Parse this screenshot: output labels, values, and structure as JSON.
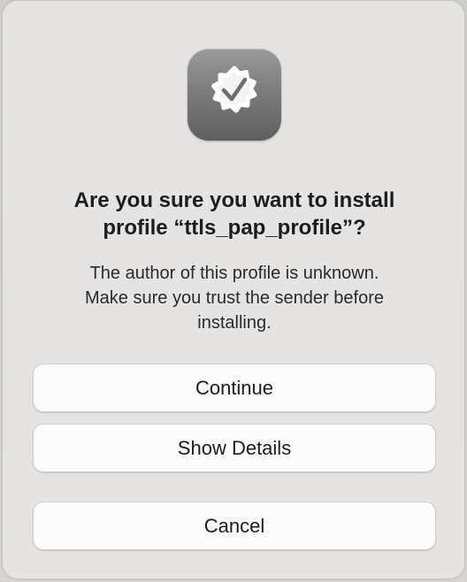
{
  "dialog": {
    "icon": "certificate-badge-checkmark-icon",
    "title_line1": "Are you sure you want to install",
    "title_line2": "profile “ttls_pap_profile”?",
    "message_line1": "The author of this profile is unknown.",
    "message_line2": "Make sure you trust the sender before",
    "message_line3": "installing."
  },
  "buttons": {
    "continue_label": "Continue",
    "show_details_label": "Show Details",
    "cancel_label": "Cancel"
  },
  "colors": {
    "dialog_bg": "#e6e4e2",
    "button_bg": "#fbfbfb",
    "icon_bg": "#7d7d7d",
    "text": "#1d1d1d"
  }
}
